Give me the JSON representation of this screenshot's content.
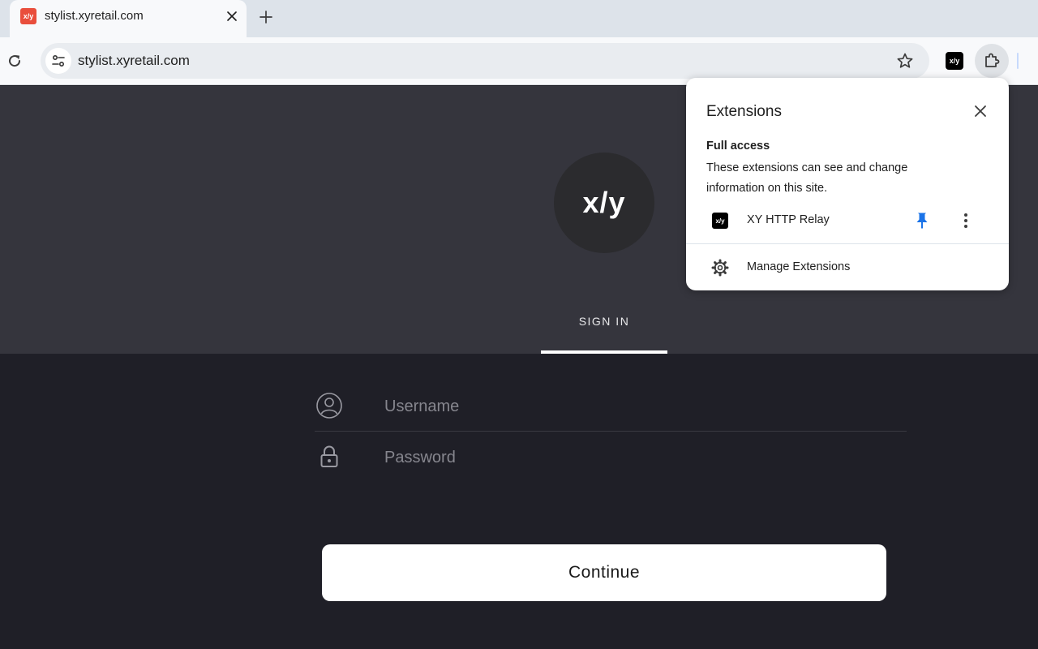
{
  "browser": {
    "tab": {
      "favicon_text": "x/y",
      "title": "stylist.xyretail.com"
    },
    "url": "stylist.xyretail.com",
    "toolbar_extension_icon_text": "x/y",
    "icons": [
      "close-icon",
      "plus-icon",
      "reload-icon",
      "tune-icon",
      "star-icon",
      "puzzle-icon"
    ]
  },
  "page": {
    "logo_text": "x/y",
    "signin_tab_label": "SIGN IN",
    "username_placeholder": "Username",
    "password_placeholder": "Password",
    "continue_label": "Continue",
    "icons": [
      "user-circle-icon",
      "lock-icon"
    ]
  },
  "extensions_popup": {
    "title": "Extensions",
    "section_heading": "Full access",
    "section_description": "These extensions can see and change information on this site.",
    "items": [
      {
        "icon_text": "x/y",
        "name": "XY HTTP Relay",
        "pinned": true
      }
    ],
    "manage_label": "Manage Extensions",
    "icons": [
      "close-icon",
      "pin-icon",
      "more-vert-icon",
      "gear-icon"
    ]
  },
  "colors": {
    "favicon": "#e94e3c",
    "pin": "#1a73e8",
    "hero_bg": "#35353d",
    "form_bg": "#1f1f27"
  }
}
